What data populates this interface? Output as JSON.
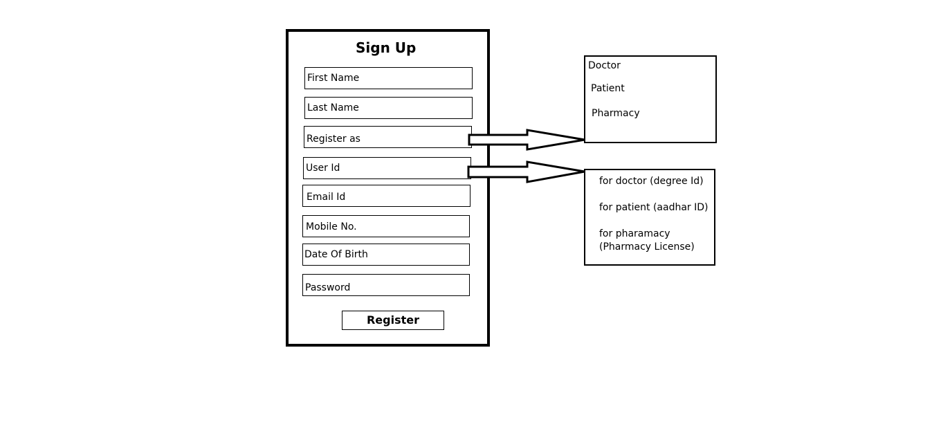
{
  "form": {
    "title": "Sign Up",
    "fields": [
      {
        "label": "First Name"
      },
      {
        "label": "Last Name"
      },
      {
        "label": "Register as"
      },
      {
        "label": "User Id"
      },
      {
        "label": "Email Id"
      },
      {
        "label": "Mobile No."
      },
      {
        "label": "Date Of Birth"
      },
      {
        "label": "Password"
      }
    ],
    "register_label": "Register"
  },
  "role_options": {
    "items": [
      "Doctor",
      "Patient",
      "Pharmacy"
    ]
  },
  "id_requirements": {
    "items": [
      "for doctor (degree Id)",
      "for patient (aadhar ID)",
      "for pharamacy",
      "(Pharmacy License)"
    ]
  }
}
